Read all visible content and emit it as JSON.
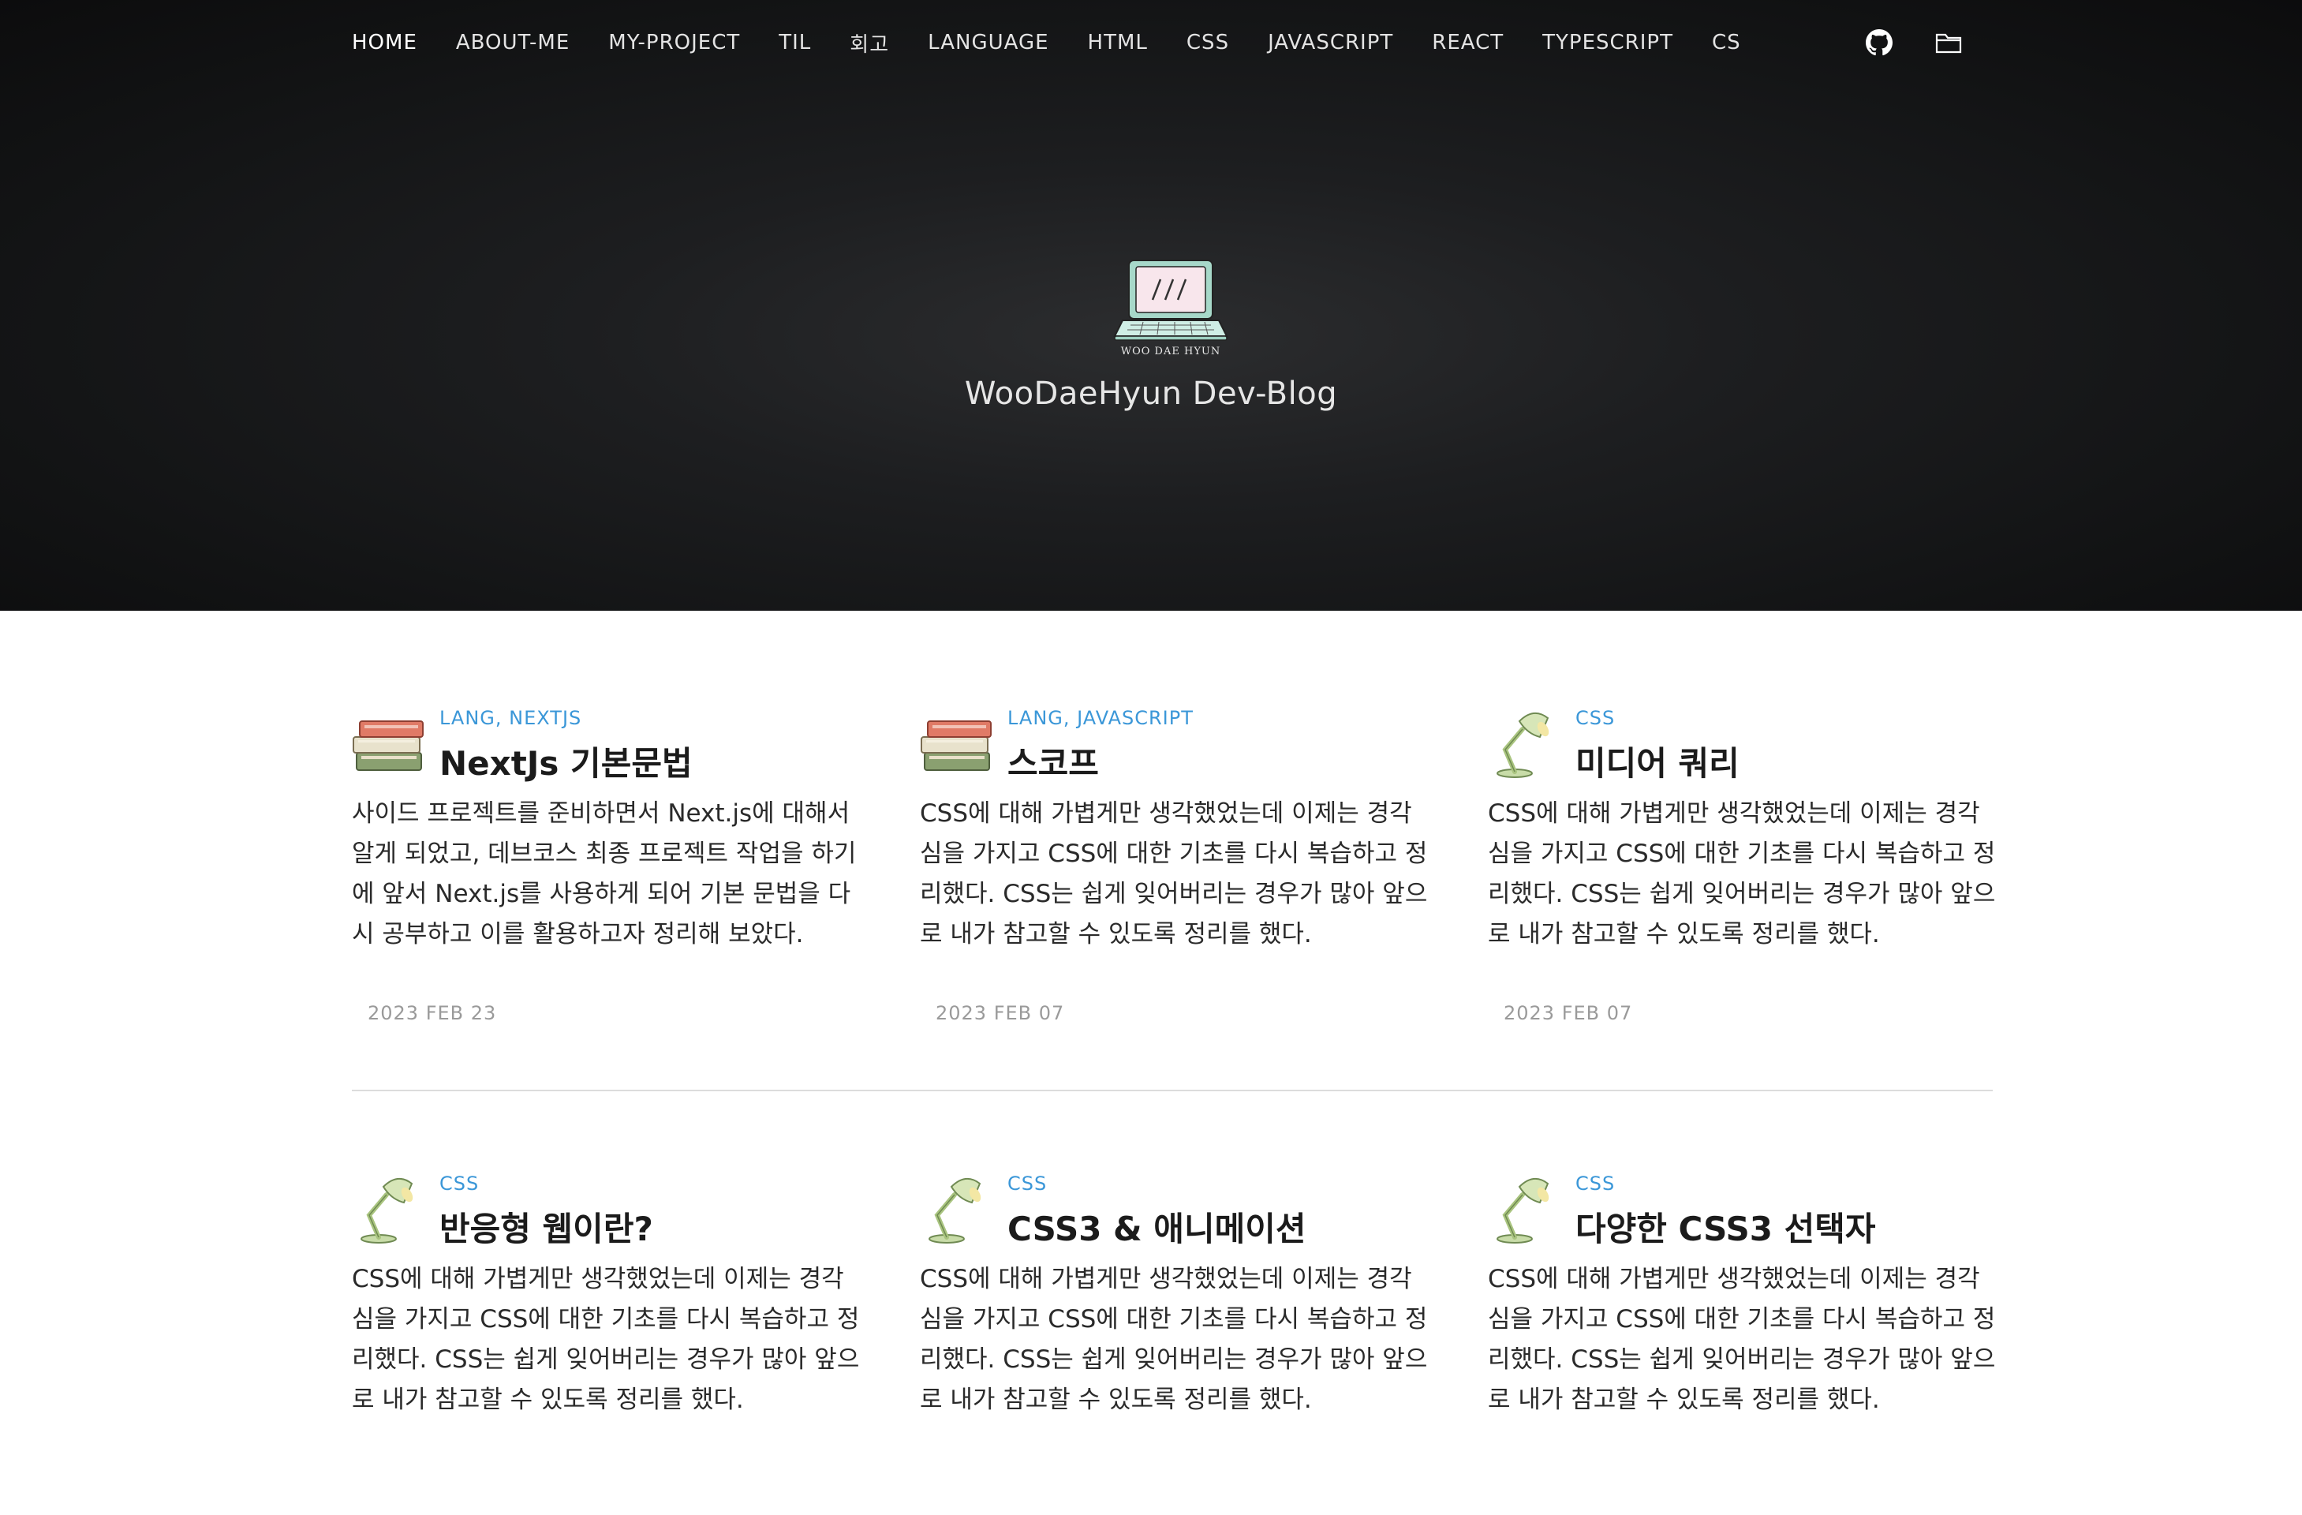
{
  "nav": {
    "items": [
      "HOME",
      "ABOUT-ME",
      "MY-PROJECT",
      "TIL",
      "회고",
      "LANGUAGE",
      "HTML",
      "CSS",
      "JAVASCRIPT",
      "REACT",
      "TYPESCRIPT",
      "CS"
    ],
    "icons": [
      "github-icon",
      "folder-icon"
    ]
  },
  "hero": {
    "logo_text": "WOO DAE HYUN",
    "title": "WooDaeHyun Dev-Blog"
  },
  "posts": [
    {
      "icon": "books-icon",
      "tags": "LANG,  NEXTJS",
      "title": "NextJs 기본문법",
      "excerpt": "사이드 프로젝트를 준비하면서 Next.js에 대해서 알게 되었고, 데브코스 최종 프로젝트 작업을 하기에 앞서 Next.js를 사용하게 되어 기본 문법을 다시 공부하고 이를 활용하고자 정리해 보았다.",
      "date": "2023 FEB 23"
    },
    {
      "icon": "books-icon",
      "tags": "LANG,  JAVASCRIPT",
      "title": "스코프",
      "excerpt": "CSS에 대해 가볍게만 생각했었는데 이제는 경각심을 가지고 CSS에 대한 기초를 다시 복습하고 정리했다. CSS는 쉽게 잊어버리는 경우가 많아 앞으로 내가 참고할 수 있도록 정리를 했다.",
      "date": "2023 FEB 07"
    },
    {
      "icon": "lamp-icon",
      "tags": "CSS",
      "title": "미디어 쿼리",
      "excerpt": "CSS에 대해 가볍게만 생각했었는데 이제는 경각심을 가지고 CSS에 대한 기초를 다시 복습하고 정리했다. CSS는 쉽게 잊어버리는 경우가 많아 앞으로 내가 참고할 수 있도록 정리를 했다.",
      "date": "2023 FEB 07"
    },
    {
      "icon": "lamp-icon",
      "tags": "CSS",
      "title": "반응형 웹이란?",
      "excerpt": "CSS에 대해 가볍게만 생각했었는데 이제는 경각심을 가지고 CSS에 대한 기초를 다시 복습하고 정리했다. CSS는 쉽게 잊어버리는 경우가 많아 앞으로 내가 참고할 수 있도록 정리를 했다.",
      "date": ""
    },
    {
      "icon": "lamp-icon",
      "tags": "CSS",
      "title": "CSS3 & 애니메이션",
      "excerpt": "CSS에 대해 가볍게만 생각했었는데 이제는 경각심을 가지고 CSS에 대한 기초를 다시 복습하고 정리했다. CSS는 쉽게 잊어버리는 경우가 많아 앞으로 내가 참고할 수 있도록 정리를 했다.",
      "date": ""
    },
    {
      "icon": "lamp-icon",
      "tags": "CSS",
      "title": "다양한 CSS3 선택자",
      "excerpt": "CSS에 대해 가볍게만 생각했었는데 이제는 경각심을 가지고 CSS에 대한 기초를 다시 복습하고 정리했다. CSS는 쉽게 잊어버리는 경우가 많아 앞으로 내가 참고할 수 있도록 정리를 했다.",
      "date": ""
    }
  ]
}
